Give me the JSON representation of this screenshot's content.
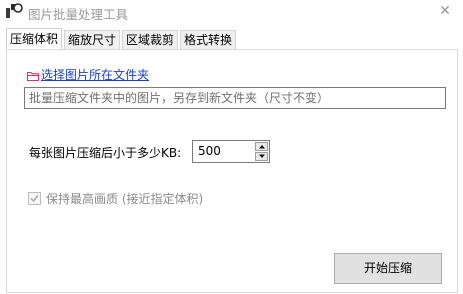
{
  "window": {
    "title": "图片批量处理工具",
    "close_glyph": "✕"
  },
  "tabs": [
    {
      "label": "压缩体积",
      "active": true
    },
    {
      "label": "缩放尺寸",
      "active": false
    },
    {
      "label": "区域裁剪",
      "active": false
    },
    {
      "label": "格式转换",
      "active": false
    }
  ],
  "compress": {
    "select_folder_link": "选择图片所在文件夹",
    "folder_icon": "folder-icon",
    "info_text": "批量压缩文件夹中的图片，另存到新文件夹（尺寸不变）",
    "size_label": "每张图片压缩后小于多少KB:",
    "size_value": "500",
    "quality_label": "保持最高画质 (接近指定体积)",
    "quality_checked": true,
    "quality_enabled": false,
    "start_button": "开始压缩"
  },
  "colors": {
    "link": "#1a3fd0",
    "folder_icon": "#e0306a",
    "disabled_text": "#8a8a8a",
    "button_bg": "#e1e1e1"
  }
}
